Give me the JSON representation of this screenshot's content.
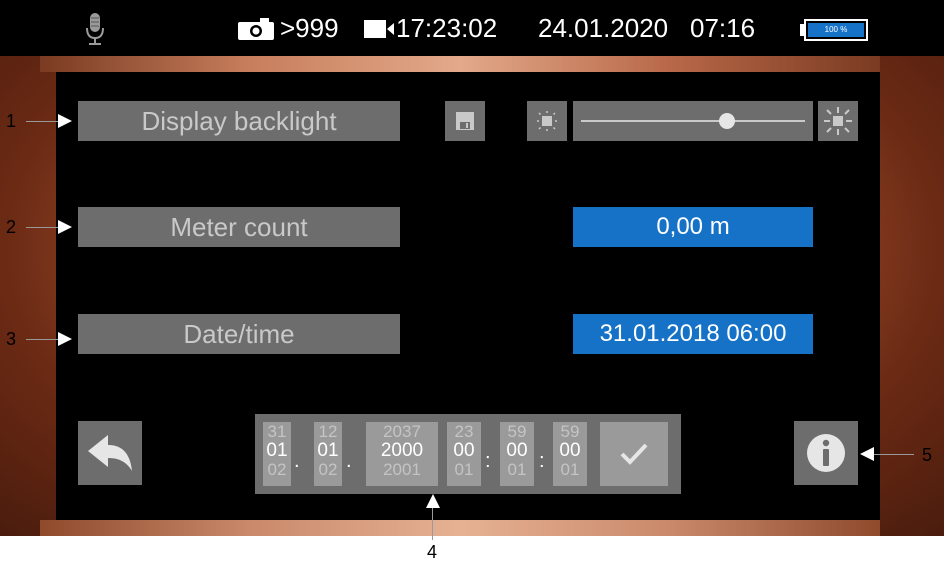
{
  "statusbar": {
    "photo_count": ">999",
    "time": "17:23:02",
    "date": "24.01.2020",
    "remaining": "07:16",
    "battery_label": "100 %"
  },
  "settings": {
    "backlight_label": "Display backlight",
    "backlight_level": 0.65,
    "meter_label": "Meter count",
    "meter_value": "0,00 m",
    "datetime_label": "Date/time",
    "datetime_value": "31.01.2018 06:00"
  },
  "picker": {
    "columns": [
      {
        "prev": "31",
        "cur": "01",
        "next": "02"
      },
      {
        "prev": "12",
        "cur": "01",
        "next": "02"
      },
      {
        "prev": "2037",
        "cur": "2000",
        "next": "2001"
      },
      {
        "prev": "23",
        "cur": "00",
        "next": "01"
      },
      {
        "prev": "59",
        "cur": "00",
        "next": "01"
      },
      {
        "prev": "59",
        "cur": "00",
        "next": "01"
      }
    ],
    "separators": [
      ".",
      ".",
      ":",
      ":"
    ]
  },
  "callouts": [
    "1",
    "2",
    "3",
    "4",
    "5"
  ]
}
